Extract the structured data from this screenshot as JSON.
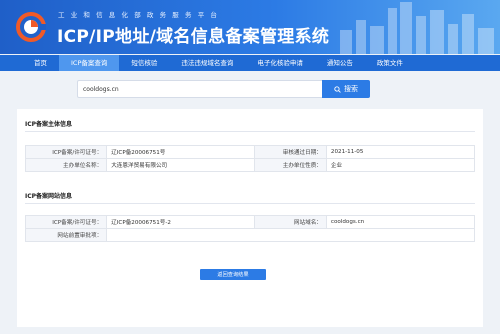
{
  "header": {
    "subtitle": "工业和信息化部政务服务平台",
    "title": "ICP/IP地址/域名信息备案管理系统"
  },
  "nav": {
    "items": [
      {
        "label": "首页",
        "active": false
      },
      {
        "label": "ICP备案查询",
        "active": true
      },
      {
        "label": "短信核验",
        "active": false
      },
      {
        "label": "违法违规域名查询",
        "active": false
      },
      {
        "label": "电子化核验申请",
        "active": false
      },
      {
        "label": "通知公告",
        "active": false
      },
      {
        "label": "政策文件",
        "active": false
      }
    ]
  },
  "search": {
    "value": "cooldogs.cn",
    "button_label": "搜索"
  },
  "subject": {
    "title": "ICP备案主体信息",
    "rows": [
      {
        "label1": "ICP备案/许可证号：",
        "value1": "辽ICP备20006751号",
        "label2": "审核通过日期：",
        "value2": "2021-11-05"
      },
      {
        "label1": "主办单位名称：",
        "value1": "大连恩洋贸易有限公司",
        "label2": "主办单位性质：",
        "value2": "企业"
      }
    ]
  },
  "website": {
    "title": "ICP备案网站信息",
    "rows": [
      {
        "label1": "ICP备案/许可证号：",
        "value1": "辽ICP备20006751号-2",
        "label2": "网站域名：",
        "value2": "cooldogs.cn"
      },
      {
        "label1": "网站前置审批项：",
        "value1": ""
      }
    ]
  },
  "back_button_label": "返回查询结果",
  "colors": {
    "primary": "#2c7be5",
    "nav": "#1f6ad4",
    "nav_active": "#4f97ee",
    "logo_orange": "#f05a28"
  }
}
